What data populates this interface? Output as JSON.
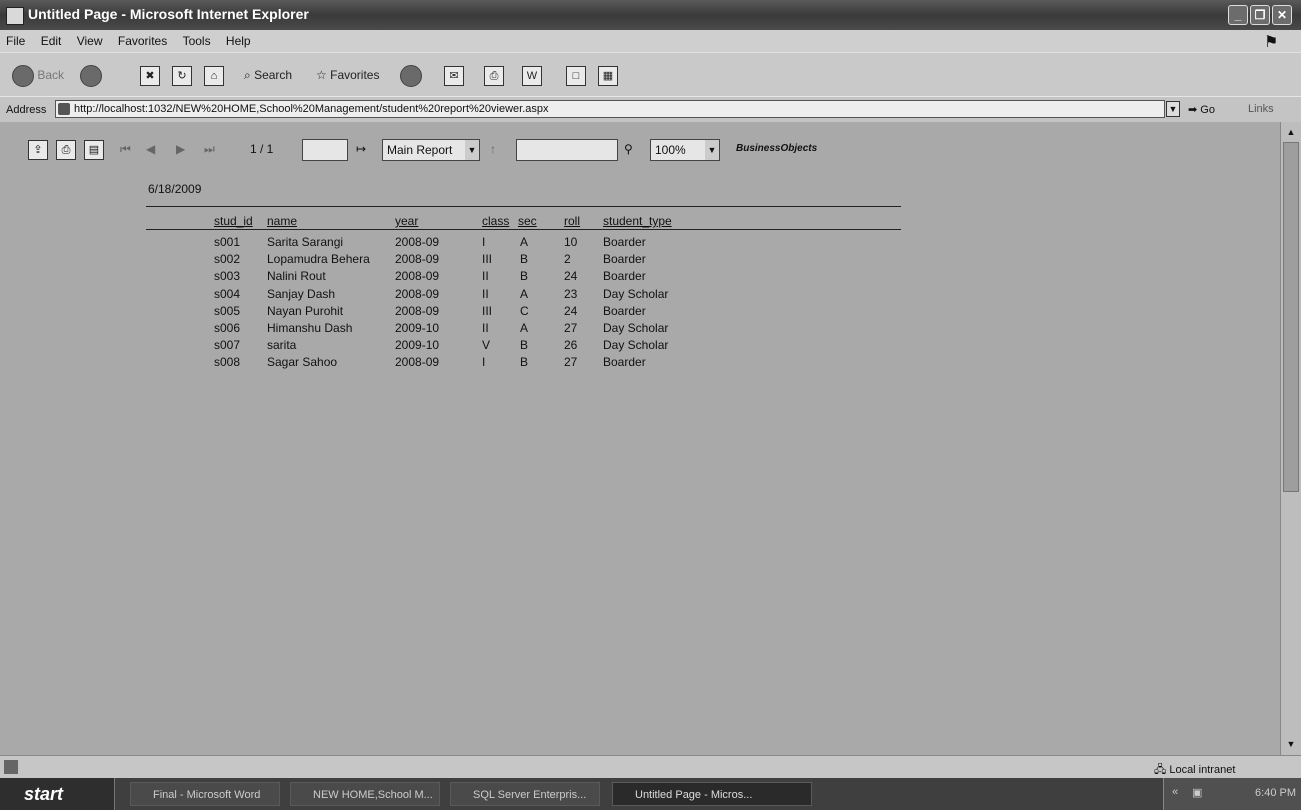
{
  "window": {
    "title": "Untitled Page - Microsoft Internet Explorer"
  },
  "menu": [
    "File",
    "Edit",
    "View",
    "Favorites",
    "Tools",
    "Help"
  ],
  "toolbar": {
    "back": "Back",
    "search": "Search",
    "favorites": "Favorites"
  },
  "address": {
    "label": "Address",
    "url": "http://localhost:1032/NEW%20HOME,School%20Management/student%20report%20viewer.aspx",
    "go": "Go",
    "links": "Links"
  },
  "report_toolbar": {
    "page_indicator": "1 / 1",
    "report_select": "Main Report",
    "zoom": "100%",
    "brand": "BusinessObjects"
  },
  "report": {
    "date": "6/18/2009",
    "columns": [
      "stud_id",
      "name",
      "year",
      "class",
      "sec",
      "roll",
      "student_type"
    ],
    "rows": [
      [
        "s001",
        "Sarita Sarangi",
        "2008-09",
        "I",
        "A",
        "10",
        "Boarder"
      ],
      [
        "s002",
        "Lopamudra Behera",
        "2008-09",
        "III",
        "B",
        "2",
        "Boarder"
      ],
      [
        "s003",
        "Nalini Rout",
        "2008-09",
        "II",
        "B",
        "24",
        "Boarder"
      ],
      [
        "s004",
        "Sanjay Dash",
        "2008-09",
        "II",
        "A",
        "23",
        "Day Scholar"
      ],
      [
        "s005",
        "Nayan Purohit",
        "2008-09",
        "III",
        "C",
        "24",
        "Boarder"
      ],
      [
        "s006",
        "Himanshu Dash",
        "2009-10",
        "II",
        "A",
        "27",
        "Day Scholar"
      ],
      [
        "s007",
        "sarita",
        "2009-10",
        "V",
        "B",
        "26",
        "Day Scholar"
      ],
      [
        "s008",
        "Sagar Sahoo",
        "2008-09",
        "I",
        "B",
        "27",
        "Boarder"
      ]
    ]
  },
  "status": {
    "zone": "Local intranet"
  },
  "taskbar": {
    "start": "start",
    "tasks": [
      "Final - Microsoft Word",
      "NEW HOME,School M...",
      "SQL Server Enterpris...",
      "Untitled Page - Micros..."
    ],
    "clock": "6:40 PM"
  }
}
